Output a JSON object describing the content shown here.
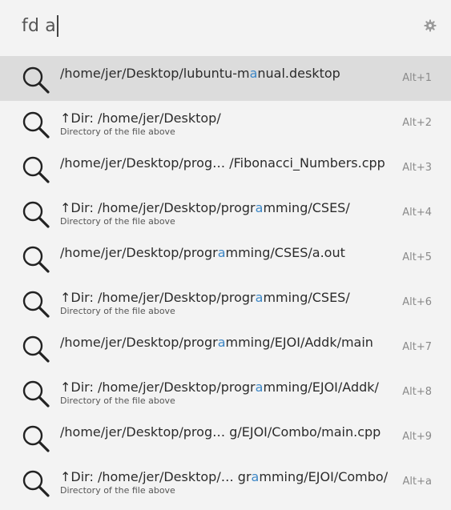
{
  "search": {
    "query": "fd a"
  },
  "results": [
    {
      "pre": "/home/jer/Desktop/lubuntu-m",
      "hl": "a",
      "post": "nual.desktop",
      "sub": "",
      "shortcut": "Alt+1"
    },
    {
      "pre": "↑Dir: /home/jer/Desktop/",
      "hl": "",
      "post": "",
      "sub": "Directory of the file above",
      "shortcut": "Alt+2"
    },
    {
      "pre": "/home/jer/Desktop/prog… /Fibonacci_Numbers.cpp",
      "hl": "",
      "post": "",
      "sub": "",
      "shortcut": "Alt+3"
    },
    {
      "pre": "↑Dir: /home/jer/Desktop/progr",
      "hl": "a",
      "post": "mming/CSES/",
      "sub": "Directory of the file above",
      "shortcut": "Alt+4"
    },
    {
      "pre": "/home/jer/Desktop/progr",
      "hl": "a",
      "post": "mming/CSES/a.out",
      "sub": "",
      "shortcut": "Alt+5"
    },
    {
      "pre": "↑Dir: /home/jer/Desktop/progr",
      "hl": "a",
      "post": "mming/CSES/",
      "sub": "Directory of the file above",
      "shortcut": "Alt+6"
    },
    {
      "pre": "/home/jer/Desktop/progr",
      "hl": "a",
      "post": "mming/EJOI/Addk/main",
      "sub": "",
      "shortcut": "Alt+7"
    },
    {
      "pre": "↑Dir: /home/jer/Desktop/progr",
      "hl": "a",
      "post": "mming/EJOI/Addk/",
      "sub": "Directory of the file above",
      "shortcut": "Alt+8"
    },
    {
      "pre": "/home/jer/Desktop/prog… g/EJOI/Combo/main.cpp",
      "hl": "",
      "post": "",
      "sub": "",
      "shortcut": "Alt+9"
    },
    {
      "pre": "↑Dir: /home/jer/Desktop/… gr",
      "hl": "a",
      "post": "mming/EJOI/Combo/",
      "sub": "Directory of the file above",
      "shortcut": "Alt+a"
    }
  ],
  "icons": {
    "result": "search-icon",
    "settings": "gear-icon"
  },
  "colors": {
    "highlight": "#3b86c6",
    "selected_row": "#dcdcdc",
    "background": "#f3f3f3"
  }
}
